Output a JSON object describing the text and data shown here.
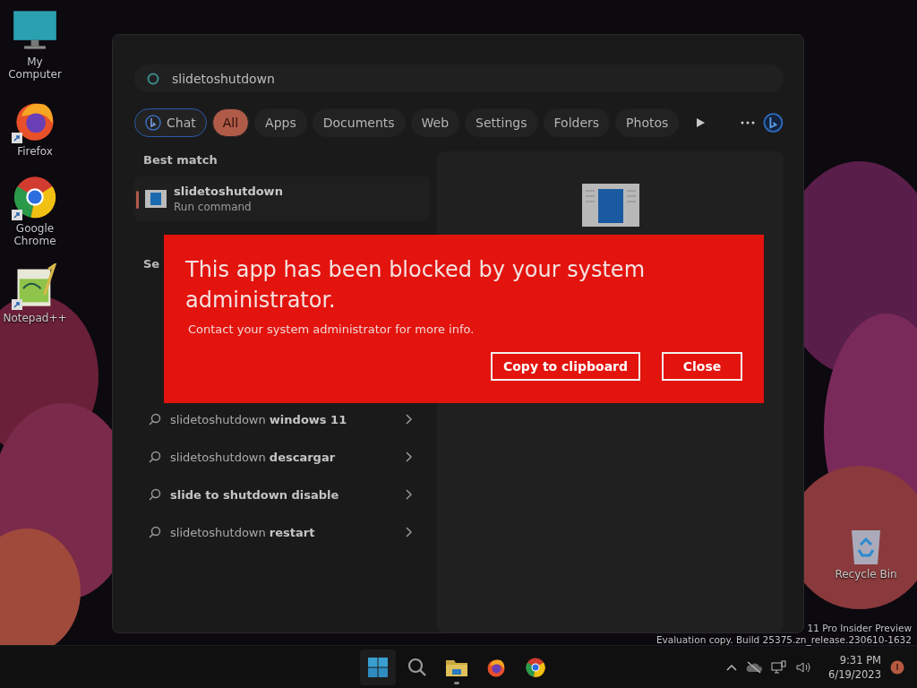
{
  "desktop_icons": [
    {
      "label": "My Computer",
      "kind": "computer",
      "shortcut": false
    },
    {
      "label": "Firefox",
      "kind": "firefox",
      "shortcut": true
    },
    {
      "label": "Google Chrome",
      "kind": "chrome",
      "shortcut": true
    },
    {
      "label": "Notepad++",
      "kind": "notepad",
      "shortcut": true
    }
  ],
  "search": {
    "value": "slidetoshutdown"
  },
  "filters": [
    {
      "label": "Chat",
      "kind": "chat",
      "selected": false
    },
    {
      "label": "All",
      "kind": "chip",
      "selected": true
    },
    {
      "label": "Apps",
      "kind": "chip",
      "selected": false
    },
    {
      "label": "Documents",
      "kind": "chip",
      "selected": false
    },
    {
      "label": "Web",
      "kind": "chip",
      "selected": false
    },
    {
      "label": "Settings",
      "kind": "chip",
      "selected": false
    },
    {
      "label": "Folders",
      "kind": "chip",
      "selected": false
    },
    {
      "label": "Photos",
      "kind": "chip",
      "selected": false
    }
  ],
  "best_match": {
    "heading": "Best match",
    "name": "slidetoshutdown",
    "type": "Run command",
    "selected": true
  },
  "suggestions": {
    "heading": "Se",
    "items": [
      "slidetoshutdown **windows 11**",
      "slidetoshutdown **descargar**",
      "**slide to shutdown disable**",
      "slidetoshutdown **restart**"
    ]
  },
  "dialog": {
    "title": "This app has been blocked by your system administrator.",
    "message": "Contact your system administrator for more info.",
    "buttons": [
      "Copy to clipboard",
      "Close"
    ]
  },
  "recycle_bin": {
    "label": "Recycle Bin"
  },
  "watermark": [
    "11 Pro Insider Preview",
    "Evaluation copy. Build 25375.zn_release.230610-1632"
  ],
  "taskbar": {
    "apps": [
      {
        "kind": "start",
        "active": true,
        "running": false
      },
      {
        "kind": "search",
        "active": false,
        "running": false
      },
      {
        "kind": "explorer",
        "active": false,
        "running": true
      },
      {
        "kind": "firefox",
        "active": false,
        "running": false
      },
      {
        "kind": "chrome",
        "active": false,
        "running": false
      }
    ],
    "time": "9:31 PM",
    "date": "6/19/2023"
  }
}
